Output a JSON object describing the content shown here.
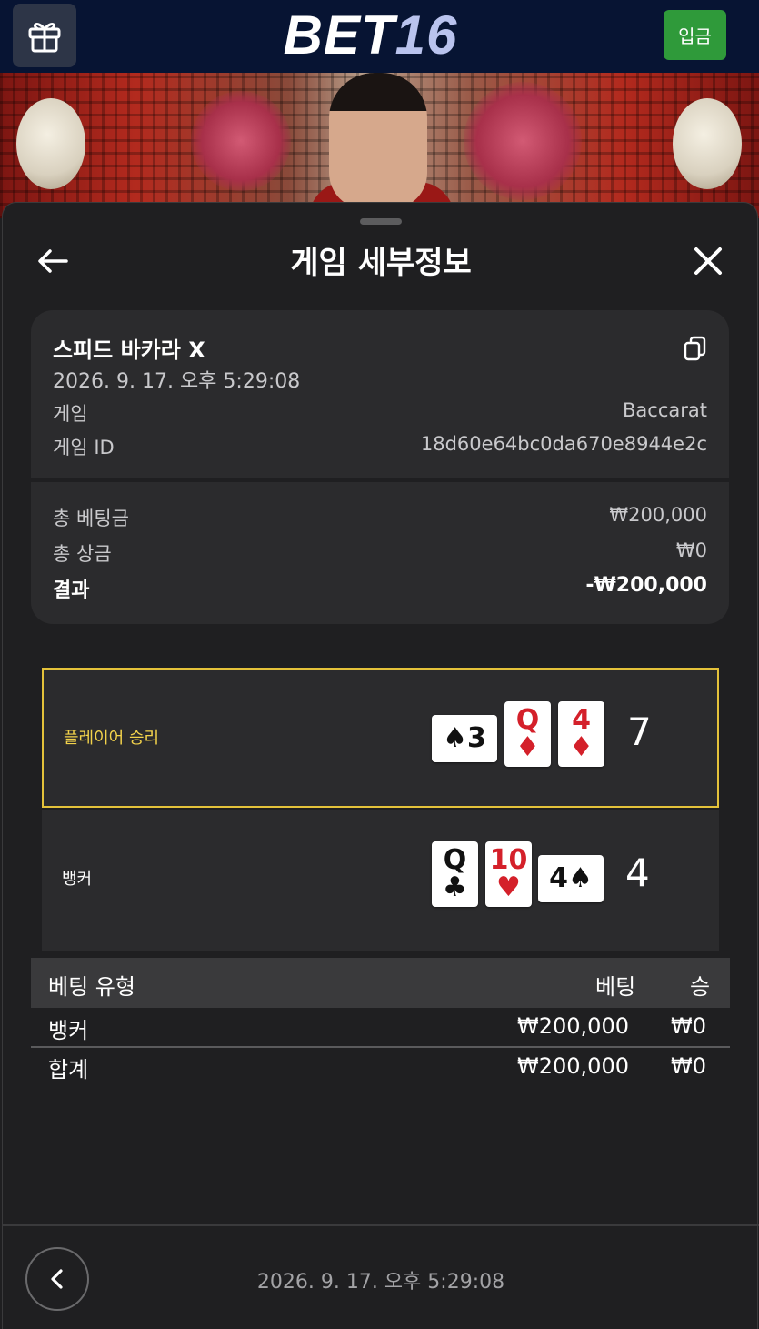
{
  "header": {
    "logo_part1": "BET",
    "logo_part2": "16",
    "deposit_label": "입금",
    "gift_icon": "gift-icon"
  },
  "sheet": {
    "title": "게임 세부정보",
    "back_icon": "back-arrow-icon",
    "close_icon": "close-icon"
  },
  "game_info": {
    "name": "스피드 바카라 X",
    "datetime": "2026. 9. 17. 오후 5:29:08",
    "copy_icon": "copy-icon",
    "game_label": "게임",
    "game_value": "Baccarat",
    "id_label": "게임 ID",
    "id_value": "18d60e64bc0da670e8944e2c"
  },
  "summary": {
    "total_bet_label": "총 베팅금",
    "total_bet_value": "₩200,000",
    "total_win_label": "총 상금",
    "total_win_value": "₩0",
    "result_label": "결과",
    "result_value": "-₩200,000"
  },
  "results": {
    "player": {
      "label": "플레이어 승리",
      "score": "7",
      "cards": [
        {
          "rank": "3",
          "suit": "♠",
          "color": "black",
          "orientation": "horizontal"
        },
        {
          "rank": "Q",
          "suit": "♦",
          "color": "red",
          "orientation": "vertical"
        },
        {
          "rank": "4",
          "suit": "♦",
          "color": "red",
          "orientation": "vertical"
        }
      ]
    },
    "banker": {
      "label": "뱅커",
      "score": "4",
      "cards": [
        {
          "rank": "Q",
          "suit": "♣",
          "color": "black",
          "orientation": "vertical"
        },
        {
          "rank": "10",
          "suit": "♥",
          "color": "red",
          "orientation": "vertical"
        },
        {
          "rank": "4",
          "suit": "♠",
          "color": "black",
          "orientation": "horizontal"
        }
      ]
    }
  },
  "bet_table": {
    "headers": [
      "베팅 유형",
      "베팅",
      "승"
    ],
    "rows": [
      [
        "뱅커",
        "₩200,000",
        "₩0"
      ],
      [
        "합계",
        "₩200,000",
        "₩0"
      ]
    ]
  },
  "footer": {
    "datetime": "2026. 9. 17. 오후 5:29:08",
    "prev_icon": "chevron-left-icon"
  },
  "colors": {
    "win_border": "#e4c23a",
    "deposit": "#2f9a3a",
    "header_bg": "#071433"
  }
}
